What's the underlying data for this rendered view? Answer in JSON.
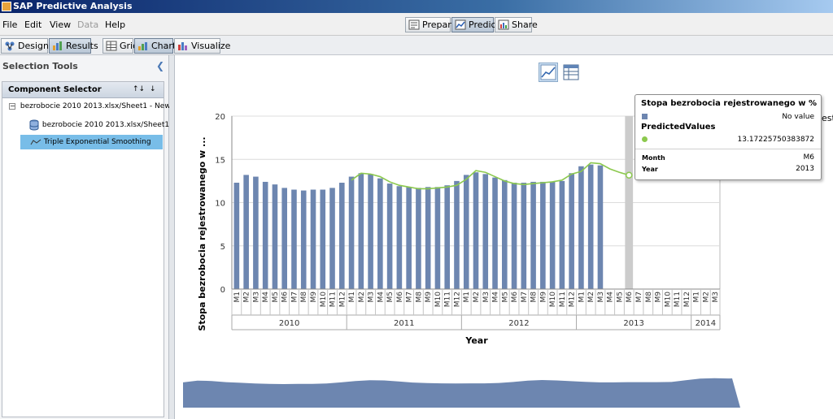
{
  "window": {
    "title": "SAP Predictive Analysis"
  },
  "menu": [
    {
      "label": "File",
      "disabled": false
    },
    {
      "label": "Edit",
      "disabled": false
    },
    {
      "label": "View",
      "disabled": false
    },
    {
      "label": "Data",
      "disabled": true
    },
    {
      "label": "Help",
      "disabled": false
    }
  ],
  "modes": {
    "prepare": "Prepare",
    "predict": "Predict",
    "share": "Share"
  },
  "subtabs": {
    "designer": "Designer",
    "results": "Results",
    "grid": "Grid",
    "charts": "Charts",
    "visualize": "Visualize"
  },
  "left": {
    "selection_tools": "Selection Tools",
    "component_selector": "Component Selector",
    "tree": {
      "root": "bezrobocie 2010 2013.xlsx/Sheet1 - New ...",
      "dataset": "bezrobocie 2010 2013.xlsx/Sheet1",
      "algorithm": "Triple Exponential Smoothing"
    }
  },
  "icons": {
    "app": "sap-icon",
    "prepare": "prepare-icon",
    "predict": "predict-icon",
    "share": "share-icon",
    "designer": "designer-icon",
    "results": "results-icon",
    "grid": "grid-icon",
    "charts": "charts-icon",
    "visualize": "visualize-icon",
    "collapse": "chevron-left-icon",
    "line_chart": "line-chart-icon",
    "table": "table-icon",
    "dataset": "database-icon",
    "algorithm": "trend-icon"
  },
  "colors": {
    "bar": "#6d86b0",
    "line": "#8cc94e",
    "selection": "#78bde8",
    "highlight_band": "#cccccc"
  },
  "tooltip": {
    "series1_name": "Stopa bezrobocia rejestrowanego w %",
    "series1_value": "No value",
    "series2_name": "PredictedValues",
    "series2_value": "13.17225750383872",
    "month_label": "Month",
    "month_value": "M6",
    "year_label": "Year",
    "year_value": "2013"
  },
  "legend_partial": "est",
  "chart_data": {
    "type": "bar",
    "ylabel": "Stopa bezrobocia rejestrowanego w ...",
    "xlabel": "Year",
    "ylim": [
      0,
      20
    ],
    "yticks": [
      0,
      5,
      10,
      15,
      20
    ],
    "grid": true,
    "categories": [
      "M1",
      "M2",
      "M3",
      "M4",
      "M5",
      "M6",
      "M7",
      "M8",
      "M9",
      "M10",
      "M11",
      "M12",
      "M1",
      "M2",
      "M3",
      "M4",
      "M5",
      "M6",
      "M7",
      "M8",
      "M9",
      "M10",
      "M11",
      "M12",
      "M1",
      "M2",
      "M3",
      "M4",
      "M5",
      "M6",
      "M7",
      "M8",
      "M9",
      "M10",
      "M11",
      "M12",
      "M1",
      "M2",
      "M3",
      "M4",
      "M5",
      "M6",
      "M7",
      "M8",
      "M9",
      "M10",
      "M11",
      "M12",
      "M1",
      "M2",
      "M3"
    ],
    "years": [
      {
        "label": "2010",
        "months": 12
      },
      {
        "label": "2011",
        "months": 12
      },
      {
        "label": "2012",
        "months": 12
      },
      {
        "label": "2013",
        "months": 12
      },
      {
        "label": "2014",
        "months": 3
      }
    ],
    "highlight_index": 41,
    "series": [
      {
        "name": "Stopa bezrobocia rejestrowanego w %",
        "type": "bar",
        "values": [
          12.3,
          13.2,
          13.0,
          12.4,
          12.1,
          11.7,
          11.5,
          11.4,
          11.5,
          11.5,
          11.7,
          12.3,
          13.0,
          13.4,
          13.3,
          12.8,
          12.2,
          11.9,
          11.8,
          11.7,
          11.8,
          11.8,
          12.0,
          12.5,
          13.2,
          13.5,
          13.3,
          12.9,
          12.6,
          12.3,
          12.3,
          12.4,
          12.4,
          12.4,
          12.5,
          13.4,
          14.2,
          14.4,
          14.3,
          null,
          null,
          null,
          null,
          null,
          null,
          null,
          null,
          null,
          null,
          null,
          null
        ]
      },
      {
        "name": "PredictedValues",
        "type": "line",
        "values": [
          null,
          null,
          null,
          null,
          null,
          null,
          null,
          null,
          null,
          null,
          null,
          null,
          12.6,
          13.4,
          13.3,
          13.0,
          12.4,
          12.0,
          11.8,
          11.6,
          11.6,
          11.7,
          11.8,
          12.0,
          12.7,
          13.7,
          13.5,
          13.0,
          12.5,
          12.2,
          12.1,
          12.2,
          12.3,
          12.4,
          12.6,
          13.3,
          13.6,
          14.6,
          14.5,
          13.9,
          13.5,
          13.17,
          null,
          null,
          null,
          null,
          null,
          null,
          null,
          null,
          null
        ]
      }
    ]
  }
}
